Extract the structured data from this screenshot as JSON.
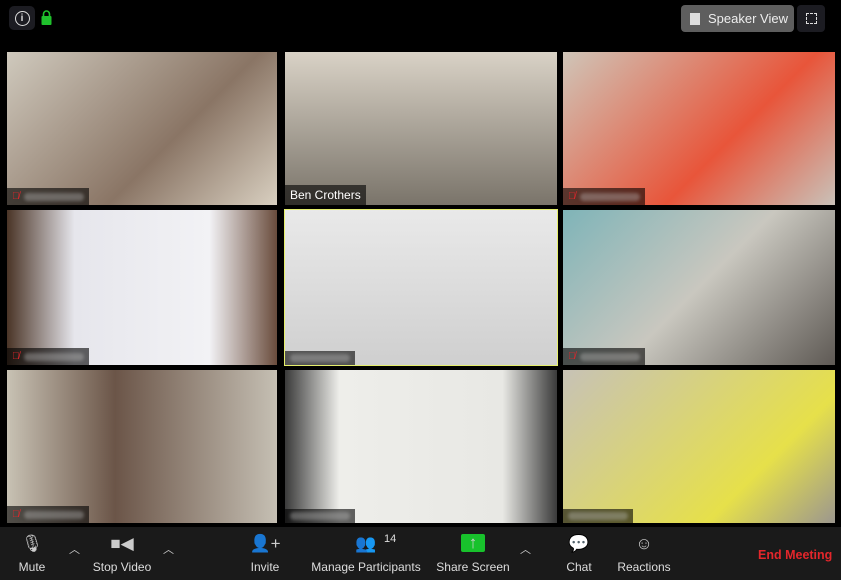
{
  "topbar": {
    "speaker_view_label": "Speaker View",
    "info_icon": "info-icon",
    "lock_icon": "lock-icon",
    "fullscreen_icon": "fullscreen-icon",
    "lock_color": "#1fc12c"
  },
  "tiles": [
    {
      "name": "",
      "muted": true,
      "bg": "linear-gradient(135deg,#cfc9bd,#8a7565 60,#d8cfc0)"
    },
    {
      "name": "Ben Crothers",
      "muted": false,
      "bg": "linear-gradient(180deg,#d9d2c6,#7a746a)"
    },
    {
      "name": "",
      "muted": true,
      "bg": "linear-gradient(135deg,#cfc5b8,#e8553a 60%,#c9c1b8)"
    },
    {
      "name": "",
      "muted": true,
      "bg": "linear-gradient(90deg,#4a3426,#e6e6ec 25%,#f2f2f5 75%,#6a4c3c)"
    },
    {
      "name": "",
      "muted": false,
      "active": true,
      "bg": "linear-gradient(180deg,#e9e9e9,#cfcfcf)"
    },
    {
      "name": "",
      "muted": true,
      "bg": "linear-gradient(135deg,#7fb4b8,#c9c7bf 50%,#5f5a55)"
    },
    {
      "name": "",
      "muted": true,
      "bg": "linear-gradient(90deg,#c8c2b4,#6b5548 40%,#c5bfb3)"
    },
    {
      "name": "",
      "muted": false,
      "bg": "linear-gradient(90deg,#3a3a3a,#eeeeea 20%,#e8e8e4 80%,#3a3a3a)"
    },
    {
      "name": "",
      "muted": false,
      "bg": "linear-gradient(135deg,#c7c2b6,#e6e04a 70%,#9c978e)"
    }
  ],
  "toolbar": {
    "mute": "Mute",
    "stop_video": "Stop Video",
    "invite": "Invite",
    "manage_participants": "Manage Participants",
    "participant_count": "14",
    "share_screen": "Share Screen",
    "chat": "Chat",
    "reactions": "Reactions",
    "end_meeting": "End Meeting",
    "end_color": "#e3262b",
    "share_color": "#18c22c"
  }
}
